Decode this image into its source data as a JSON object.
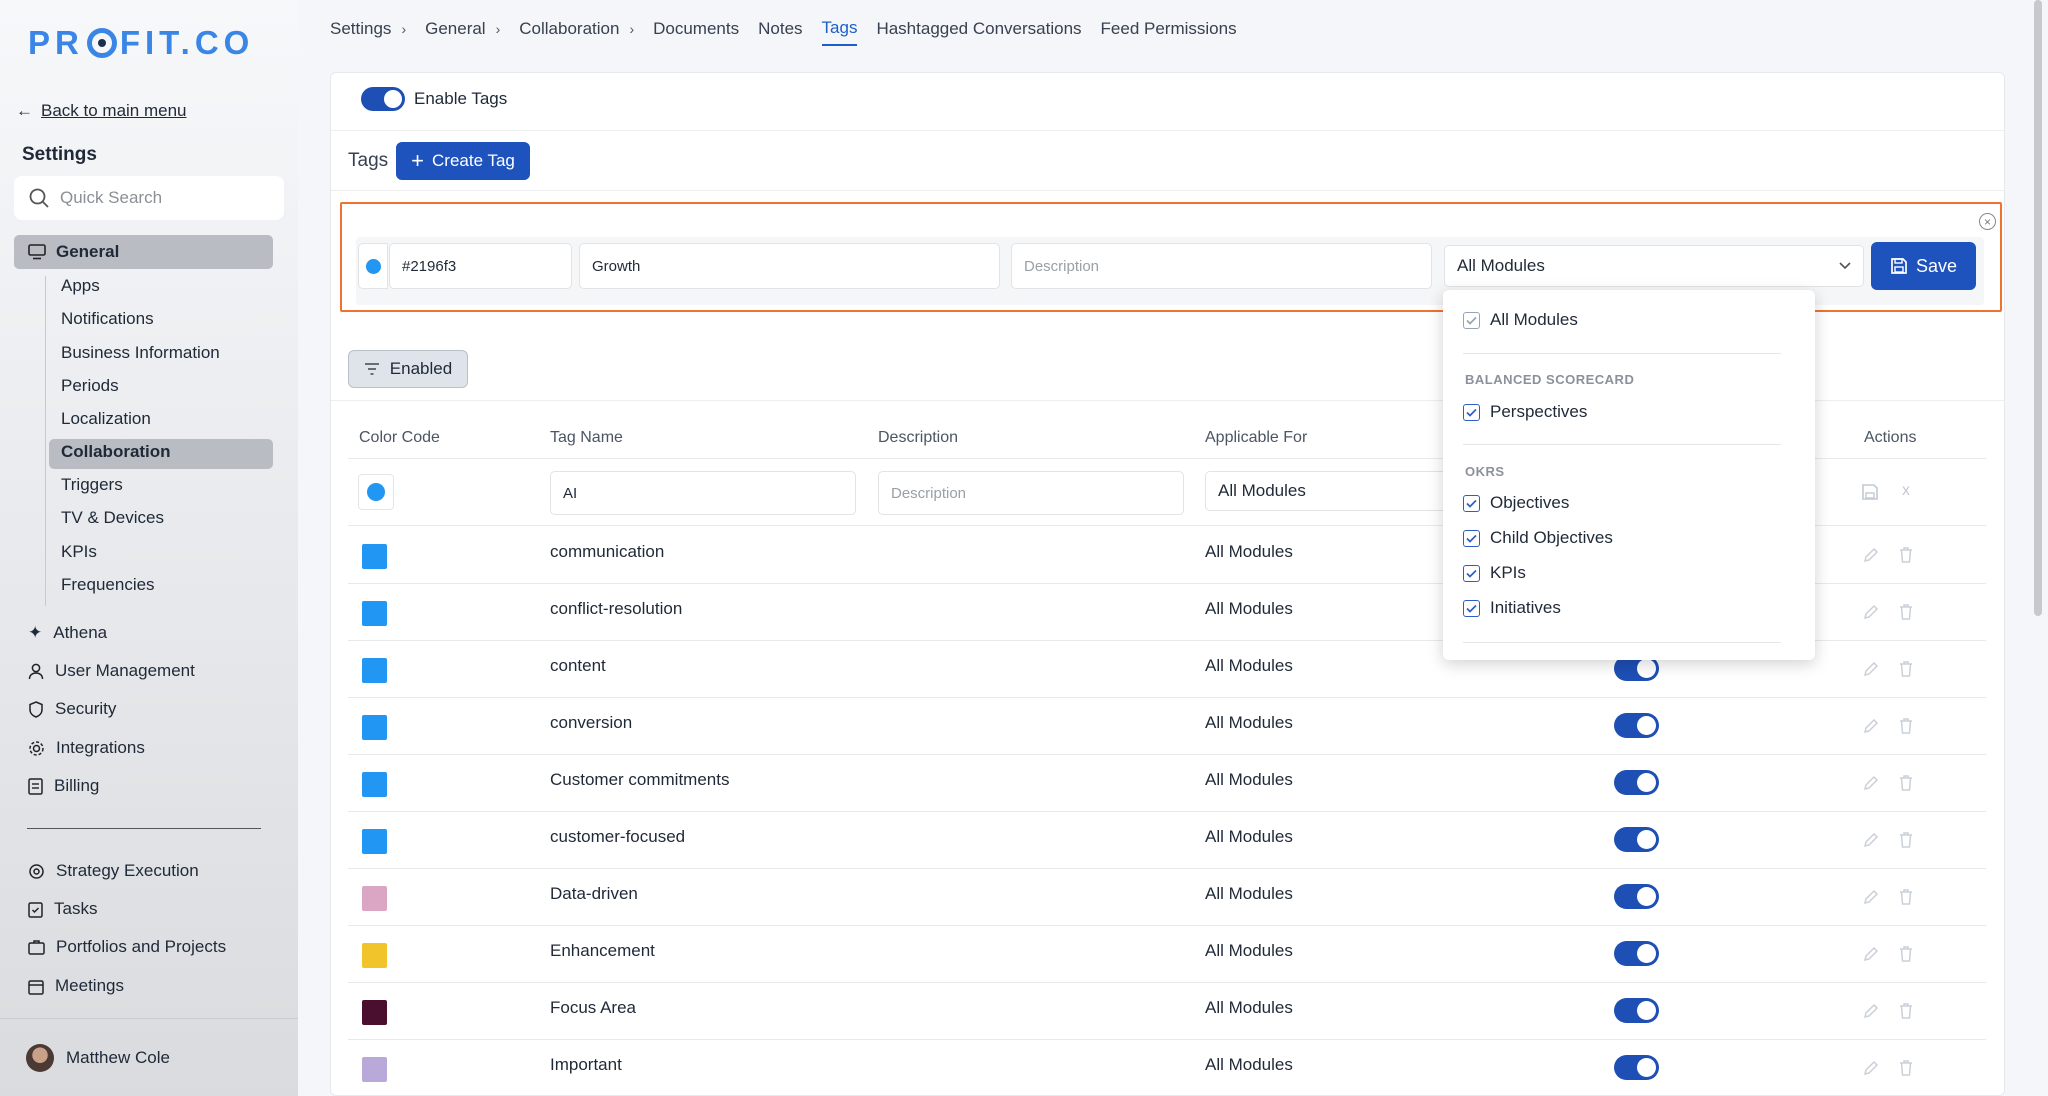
{
  "app": {
    "logo": "PROFIT.CO"
  },
  "sidebar": {
    "back_label": "Back to main menu",
    "title": "Settings",
    "search_placeholder": "Quick Search",
    "general_label": "General",
    "sub_items": [
      "Apps",
      "Notifications",
      "Business Information",
      "Periods",
      "Localization",
      "Collaboration",
      "Triggers",
      "TV & Devices",
      "KPIs",
      "Frequencies"
    ],
    "items": [
      {
        "label": "Athena",
        "icon": "sparkle-icon"
      },
      {
        "label": "User Management",
        "icon": "user-icon"
      },
      {
        "label": "Security",
        "icon": "shield-icon"
      },
      {
        "label": "Integrations",
        "icon": "gear-icon"
      },
      {
        "label": "Billing",
        "icon": "receipt-icon"
      }
    ],
    "items2": [
      {
        "label": "Strategy Execution",
        "icon": "target-icon"
      },
      {
        "label": "Tasks",
        "icon": "clipboard-icon"
      },
      {
        "label": "Portfolios and Projects",
        "icon": "briefcase-icon"
      },
      {
        "label": "Meetings",
        "icon": "calendar-icon"
      }
    ],
    "user": {
      "name": "Matthew Cole"
    }
  },
  "breadcrumb": [
    {
      "label": "Settings"
    },
    {
      "label": "General"
    },
    {
      "label": "Collaboration"
    }
  ],
  "tabs": [
    {
      "label": "Documents"
    },
    {
      "label": "Notes"
    },
    {
      "label": "Tags",
      "active": true
    },
    {
      "label": "Hashtagged Conversations"
    },
    {
      "label": "Feed Permissions"
    }
  ],
  "main": {
    "enable_tags_label": "Enable Tags",
    "tags_label": "Tags",
    "create_tag_label": "Create Tag",
    "editor": {
      "color_value": "#2196f3",
      "name_value": "Growth",
      "description_placeholder": "Description",
      "module_value": "All Modules",
      "save_label": "Save"
    },
    "filter_label": "Enabled",
    "columns": [
      "Color Code",
      "Tag Name",
      "Description",
      "Applicable For",
      "Actions"
    ],
    "new_row": {
      "name_value": "AI",
      "description_placeholder": "Description",
      "module_value": "All Modules"
    },
    "rows": [
      {
        "color": "#2196f3",
        "name": "communication",
        "applicable": "All Modules"
      },
      {
        "color": "#2196f3",
        "name": "conflict-resolution",
        "applicable": "All Modules"
      },
      {
        "color": "#2196f3",
        "name": "content",
        "applicable": "All Modules",
        "enabled": true
      },
      {
        "color": "#2196f3",
        "name": "conversion",
        "applicable": "All Modules",
        "enabled": true
      },
      {
        "color": "#2196f3",
        "name": "Customer commitments",
        "applicable": "All Modules",
        "enabled": true
      },
      {
        "color": "#2196f3",
        "name": "customer-focused",
        "applicable": "All Modules",
        "enabled": true
      },
      {
        "color": "#dba6c4",
        "name": "Data-driven",
        "applicable": "All Modules",
        "enabled": true
      },
      {
        "color": "#f2c42b",
        "name": "Enhancement",
        "applicable": "All Modules",
        "enabled": true
      },
      {
        "color": "#4a0f2e",
        "name": "Focus Area",
        "applicable": "All Modules",
        "enabled": true
      },
      {
        "color": "#b9a9d9",
        "name": "Important",
        "applicable": "All Modules",
        "enabled": true
      }
    ]
  },
  "dropdown": {
    "all_label": "All Modules",
    "sections": [
      {
        "title": "BALANCED SCORECARD",
        "options": [
          "Perspectives"
        ]
      },
      {
        "title": "OKRS",
        "options": [
          "Objectives",
          "Child Objectives",
          "KPIs",
          "Initiatives"
        ]
      }
    ]
  },
  "colors": {
    "accent": "#1e52bd",
    "highlight": "#f0732d",
    "sidebar_active": "#b9bdc3"
  }
}
